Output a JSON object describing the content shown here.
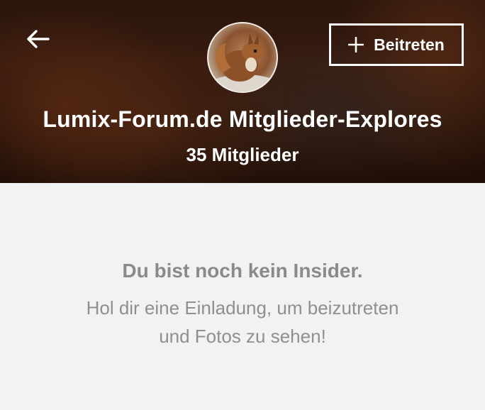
{
  "header": {
    "title": "Lumix-Forum.de Mitglieder-Explores",
    "member_count": "35 Mitglieder",
    "join_button_label": "Beitreten",
    "back_icon": "arrow-left-icon",
    "join_icon": "plus-icon",
    "text_color": "#ffffff"
  },
  "content": {
    "heading": "Du bist noch kein Insider.",
    "message": "Hol dir eine Einladung, um beizutreten und Fotos zu sehen!",
    "text_color": "#8a8a8a",
    "background": "#f2f2f2"
  }
}
